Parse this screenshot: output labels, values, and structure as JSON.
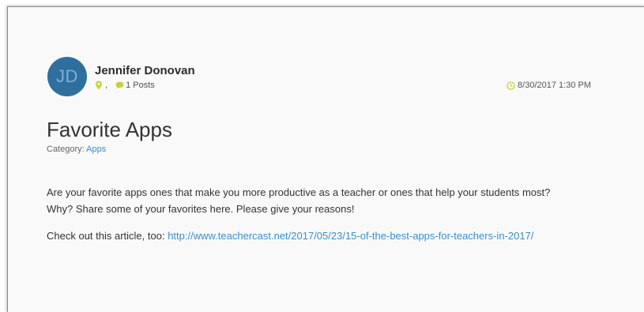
{
  "post": {
    "author": {
      "initials": "JD",
      "name": "Jennifer Donovan",
      "location_separator": ",",
      "posts_count": "1 Posts"
    },
    "date": "8/30/2017 1:30 PM",
    "title": "Favorite Apps",
    "category": {
      "label": "Category:",
      "value": "Apps"
    },
    "body": {
      "paragraph1_line1": "Are your favorite apps ones that make you more productive as a teacher or ones that help your students most?",
      "paragraph1_line2": "Why?  Share some of your favorites here. Please give your reasons!",
      "paragraph2_text": "Check out this article, too:",
      "paragraph2_link": "http://www.teachercast.net/2017/05/23/15-of-the-best-apps-for-teachers-in-2017/"
    }
  },
  "colors": {
    "avatar_bg": "#2e6f9e",
    "link": "#3d8fc4",
    "icon_accent": "#c8d23a"
  },
  "icons": {
    "location": "map-pin-icon",
    "posts": "comment-bubble-icon",
    "date": "clock-icon"
  }
}
